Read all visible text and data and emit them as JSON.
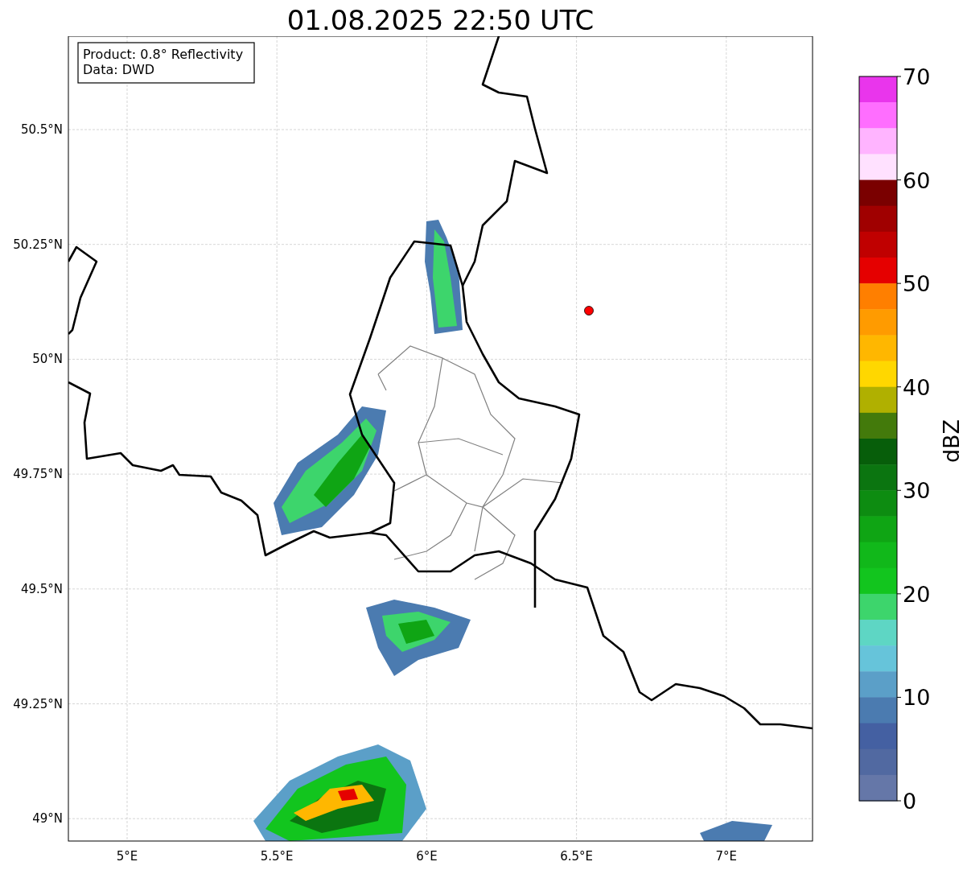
{
  "title": "01.08.2025 22:50 UTC",
  "info_box": [
    "Product: 0.8° Reflectivity",
    "Data: DWD"
  ],
  "map": {
    "lat_labels": [
      "50.5°N",
      "50.25°N",
      "50°N",
      "49.75°N",
      "49.5°N",
      "49.25°N",
      "49°N"
    ],
    "lon_labels": [
      "5°E",
      "5.5°E",
      "6°E",
      "6.5°E",
      "7°E"
    ]
  },
  "colorbar": {
    "label": "dBZ",
    "ticks": [
      "70",
      "60",
      "50",
      "40",
      "30",
      "20",
      "10",
      "0"
    ],
    "bins": [
      {
        "color": "#e935ec"
      },
      {
        "color": "#ff6eff"
      },
      {
        "color": "#ffb4ff"
      },
      {
        "color": "#ffe1ff"
      },
      {
        "color": "#7a0000"
      },
      {
        "color": "#a00000"
      },
      {
        "color": "#c00000"
      },
      {
        "color": "#e50000"
      },
      {
        "color": "#ff7f00"
      },
      {
        "color": "#ff9b00"
      },
      {
        "color": "#ffb700"
      },
      {
        "color": "#ffd700"
      },
      {
        "color": "#b0b000"
      },
      {
        "color": "#437a0b"
      },
      {
        "color": "#075e0a"
      },
      {
        "color": "#0b7510"
      },
      {
        "color": "#0d8c11"
      },
      {
        "color": "#0fa514"
      },
      {
        "color": "#11b81a"
      },
      {
        "color": "#12c51e"
      },
      {
        "color": "#3dd56c"
      },
      {
        "color": "#5ed6c4"
      },
      {
        "color": "#66c4da"
      },
      {
        "color": "#5b9fc8"
      },
      {
        "color": "#4b7bb0"
      },
      {
        "color": "#4460a2"
      },
      {
        "color": "#5169a1"
      },
      {
        "color": "#6577a8"
      }
    ]
  }
}
